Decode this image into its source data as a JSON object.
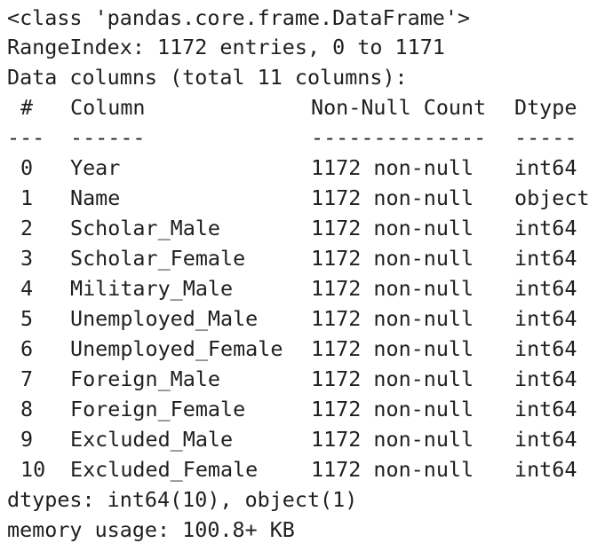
{
  "header": {
    "class_line": "<class 'pandas.core.frame.DataFrame'>",
    "range_line": "RangeIndex: 1172 entries, 0 to 1171",
    "columns_line": "Data columns (total 11 columns):"
  },
  "table": {
    "headers": {
      "idx": "#",
      "column": "Column",
      "non_null": "Non-Null Count",
      "dtype": "Dtype"
    },
    "separators": {
      "idx": "---",
      "column": "------",
      "non_null": "--------------",
      "dtype": "-----"
    },
    "rows": [
      {
        "idx": "0",
        "column": "Year",
        "non_null": "1172 non-null",
        "dtype": "int64"
      },
      {
        "idx": "1",
        "column": "Name",
        "non_null": "1172 non-null",
        "dtype": "object"
      },
      {
        "idx": "2",
        "column": "Scholar_Male",
        "non_null": "1172 non-null",
        "dtype": "int64"
      },
      {
        "idx": "3",
        "column": "Scholar_Female",
        "non_null": "1172 non-null",
        "dtype": "int64"
      },
      {
        "idx": "4",
        "column": "Military_Male",
        "non_null": "1172 non-null",
        "dtype": "int64"
      },
      {
        "idx": "5",
        "column": "Unemployed_Male",
        "non_null": "1172 non-null",
        "dtype": "int64"
      },
      {
        "idx": "6",
        "column": "Unemployed_Female",
        "non_null": "1172 non-null",
        "dtype": "int64"
      },
      {
        "idx": "7",
        "column": "Foreign_Male",
        "non_null": "1172 non-null",
        "dtype": "int64"
      },
      {
        "idx": "8",
        "column": "Foreign_Female",
        "non_null": "1172 non-null",
        "dtype": "int64"
      },
      {
        "idx": "9",
        "column": "Excluded_Male",
        "non_null": "1172 non-null",
        "dtype": "int64"
      },
      {
        "idx": "10",
        "column": "Excluded_Female",
        "non_null": "1172 non-null",
        "dtype": "int64"
      }
    ]
  },
  "footer": {
    "dtypes_line": "dtypes: int64(10), object(1)",
    "memory_line": "memory usage: 100.8+ KB"
  }
}
